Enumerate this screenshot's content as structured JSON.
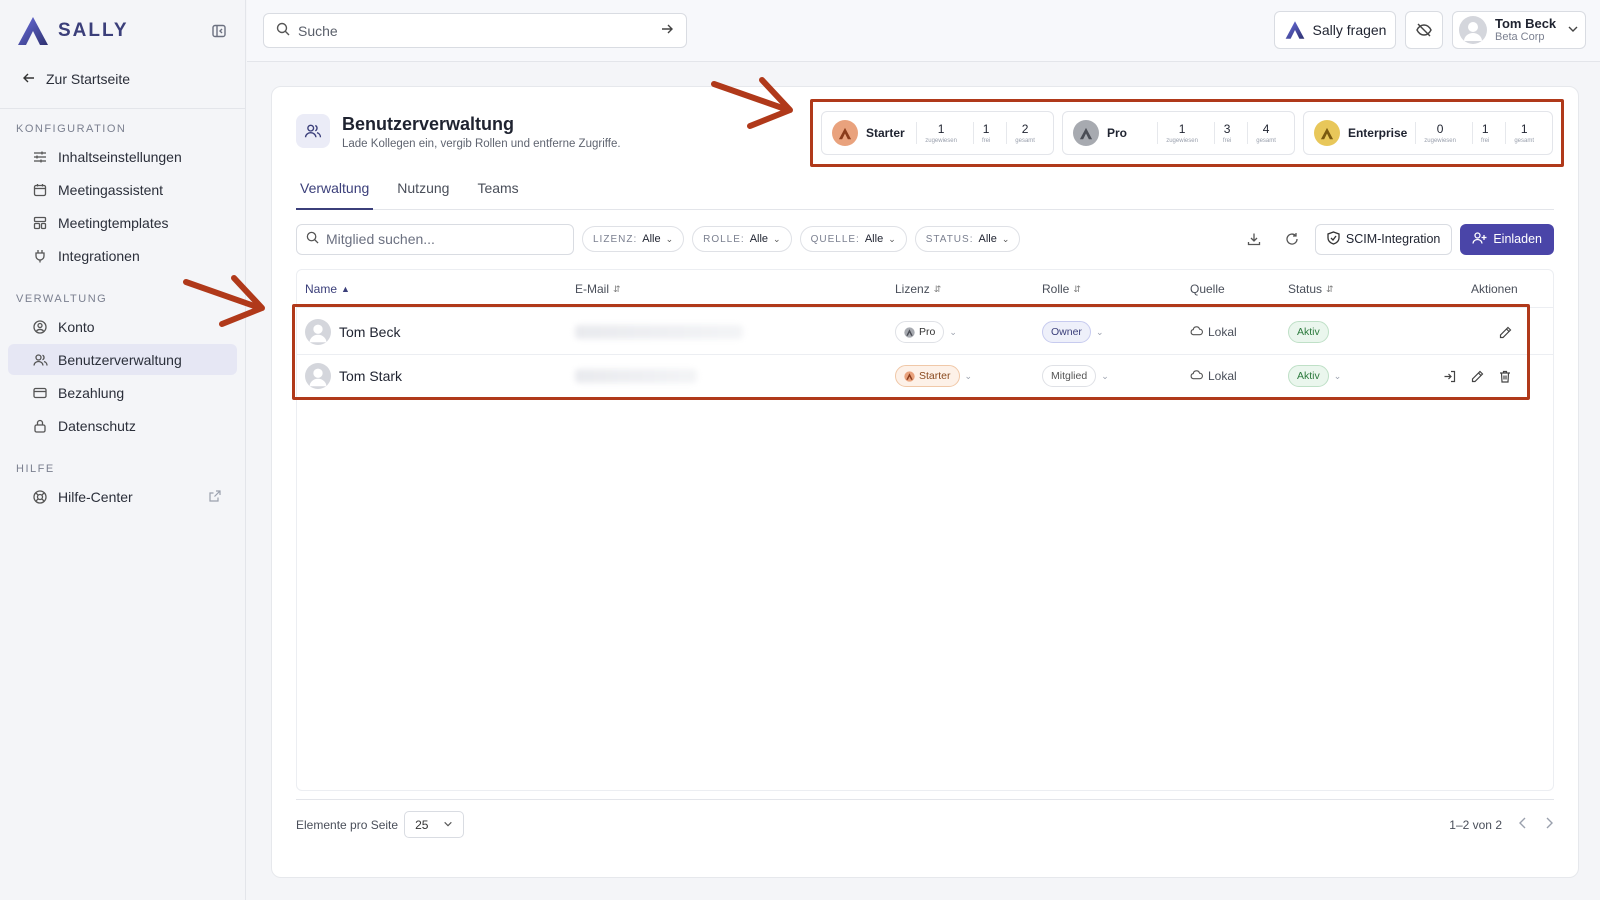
{
  "brand": {
    "name": "SALLY",
    "accent": "#3b3f7a",
    "annotation_color": "#b0391a"
  },
  "sidebar": {
    "back": "Zur Startseite",
    "sections": [
      {
        "title": "KONFIGURATION",
        "items": [
          {
            "label": "Inhaltseinstellungen",
            "icon": "sliders-icon"
          },
          {
            "label": "Meetingassistent",
            "icon": "calendar-icon"
          },
          {
            "label": "Meetingtemplates",
            "icon": "template-icon"
          },
          {
            "label": "Integrationen",
            "icon": "plug-icon"
          }
        ]
      },
      {
        "title": "VERWALTUNG",
        "items": [
          {
            "label": "Konto",
            "icon": "user-circle-icon"
          },
          {
            "label": "Benutzerverwaltung",
            "icon": "users-icon",
            "active": true
          },
          {
            "label": "Bezahlung",
            "icon": "card-icon"
          },
          {
            "label": "Datenschutz",
            "icon": "lock-icon"
          }
        ]
      },
      {
        "title": "HILFE",
        "items": [
          {
            "label": "Hilfe-Center",
            "icon": "lifebuoy-icon"
          }
        ]
      }
    ]
  },
  "topbar": {
    "search_placeholder": "Suche",
    "ask_label": "Sally fragen",
    "user": {
      "name": "Tom Beck",
      "org": "Beta Corp"
    }
  },
  "page": {
    "title": "Benutzerverwaltung",
    "subtitle": "Lade Kollegen ein, vergib Rollen und entferne Zugriffe."
  },
  "licenses": [
    {
      "name": "Starter",
      "assigned": "1",
      "free": "1",
      "total": "2",
      "color": "#d9835a"
    },
    {
      "name": "Pro",
      "assigned": "1",
      "free": "3",
      "total": "4",
      "color": "#8c8f96"
    },
    {
      "name": "Enterprise",
      "assigned": "0",
      "free": "1",
      "total": "1",
      "color": "#d9b23a"
    }
  ],
  "license_labels": {
    "assigned": "zugewiesen",
    "free": "frei",
    "total": "gesamt"
  },
  "tabs": [
    "Verwaltung",
    "Nutzung",
    "Teams"
  ],
  "filters": {
    "search_placeholder": "Mitglied suchen...",
    "chips": [
      {
        "key": "LIZENZ:",
        "value": "Alle"
      },
      {
        "key": "ROLLE:",
        "value": "Alle"
      },
      {
        "key": "QUELLE:",
        "value": "Alle"
      },
      {
        "key": "STATUS:",
        "value": "Alle"
      }
    ],
    "scim_label": "SCIM-Integration",
    "invite_label": "Einladen"
  },
  "table": {
    "columns": [
      "Name",
      "E-Mail",
      "Lizenz",
      "Rolle",
      "Quelle",
      "Status",
      "Aktionen"
    ],
    "rows": [
      {
        "name": "Tom Beck",
        "license": "Pro",
        "role": "Owner",
        "source": "Lokal",
        "status": "Aktiv"
      },
      {
        "name": "Tom Stark",
        "license": "Starter",
        "role": "Mitglied",
        "source": "Lokal",
        "status": "Aktiv"
      }
    ]
  },
  "footer": {
    "per_page_label": "Elemente pro Seite",
    "per_page_value": "25",
    "range": "1–2 von 2"
  }
}
